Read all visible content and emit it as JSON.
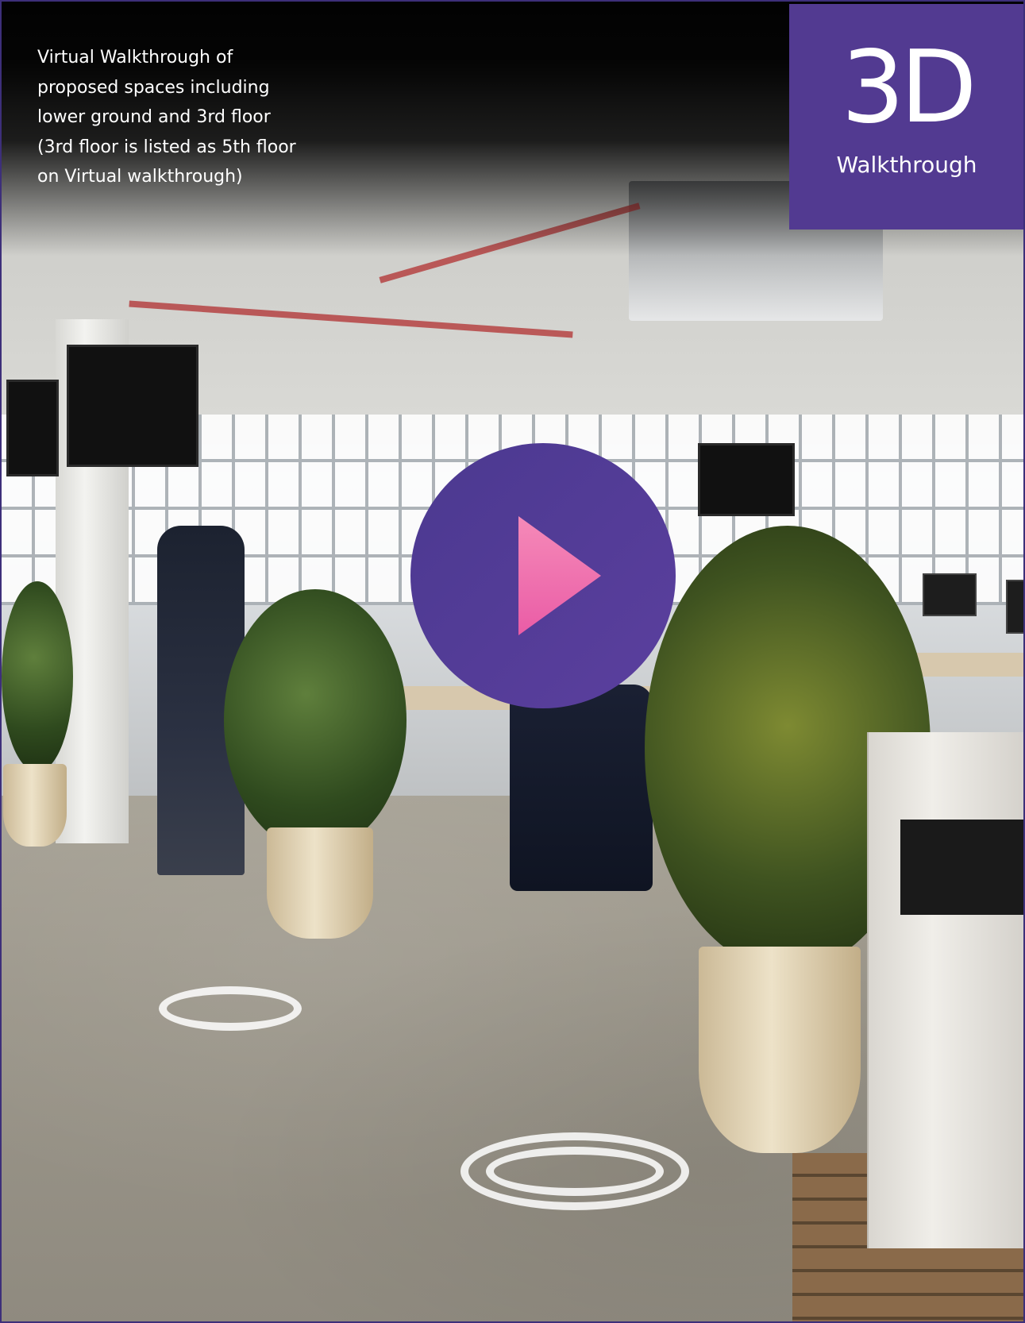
{
  "caption": {
    "text": "Virtual Walkthrough of\nproposed spaces including\nlower ground and 3rd floor\n(3rd floor is listed as 5th floor\non Virtual walkthrough)"
  },
  "badge": {
    "big": "3D",
    "small": "Walkthrough",
    "color": "#523a91"
  },
  "play_button": {
    "icon": "play-icon",
    "color": "#523a91",
    "icon_color": "#ee5fa7"
  }
}
